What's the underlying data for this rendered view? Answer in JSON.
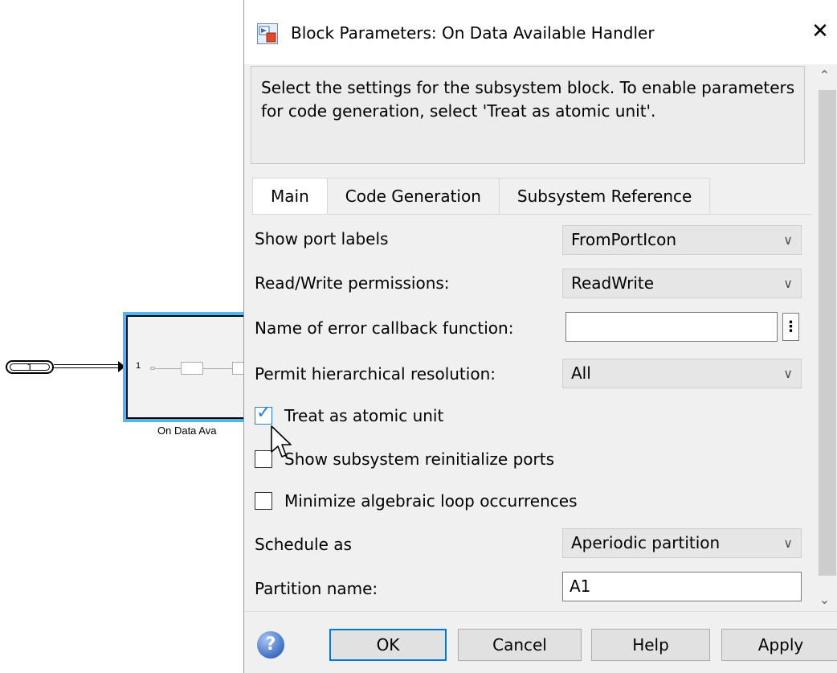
{
  "canvas": {
    "inport_number": "1",
    "subsystem_port_number": "1",
    "block_label": "On Data Ava"
  },
  "dialog": {
    "title": "Block Parameters: On Data Available Handler",
    "close_glyph": "✕",
    "description": "Select the settings for the subsystem block. To enable parameters for code generation, select 'Treat as atomic unit'.",
    "tabs": [
      {
        "label": "Main",
        "active": true
      },
      {
        "label": "Code Generation",
        "active": false
      },
      {
        "label": "Subsystem Reference",
        "active": false
      }
    ],
    "fields": {
      "show_port_labels": {
        "label": "Show port labels",
        "value": "FromPortIcon"
      },
      "read_write": {
        "label": "Read/Write permissions:",
        "value": "ReadWrite"
      },
      "error_callback": {
        "label": "Name of error callback function:",
        "value": "",
        "menu_glyph": "⋮"
      },
      "hierarchical": {
        "label": "Permit hierarchical resolution:",
        "value": "All"
      },
      "treat_atomic": {
        "label": "Treat as atomic unit",
        "checked": true
      },
      "show_reinit": {
        "label": "Show subsystem reinitialize ports",
        "checked": false
      },
      "minimize_loop": {
        "label": "Minimize algebraic loop occurrences",
        "checked": false
      },
      "schedule_as": {
        "label": "Schedule as",
        "value": "Aperiodic partition"
      },
      "partition_name": {
        "label": "Partition name:",
        "value": "A1"
      }
    },
    "chevron_glyph": "∨",
    "buttons": {
      "help_icon": "?",
      "ok": "OK",
      "cancel": "Cancel",
      "help": "Help",
      "apply": "Apply"
    }
  },
  "icons": {
    "app": "block-parameters-icon",
    "close": "close-icon",
    "help": "help-icon",
    "cursor": "mouse-pointer-icon"
  },
  "colors": {
    "selection_blue": "#4fb6f5",
    "checkbox_blue": "#2a7fd4",
    "default_button_border": "#0078d7"
  }
}
